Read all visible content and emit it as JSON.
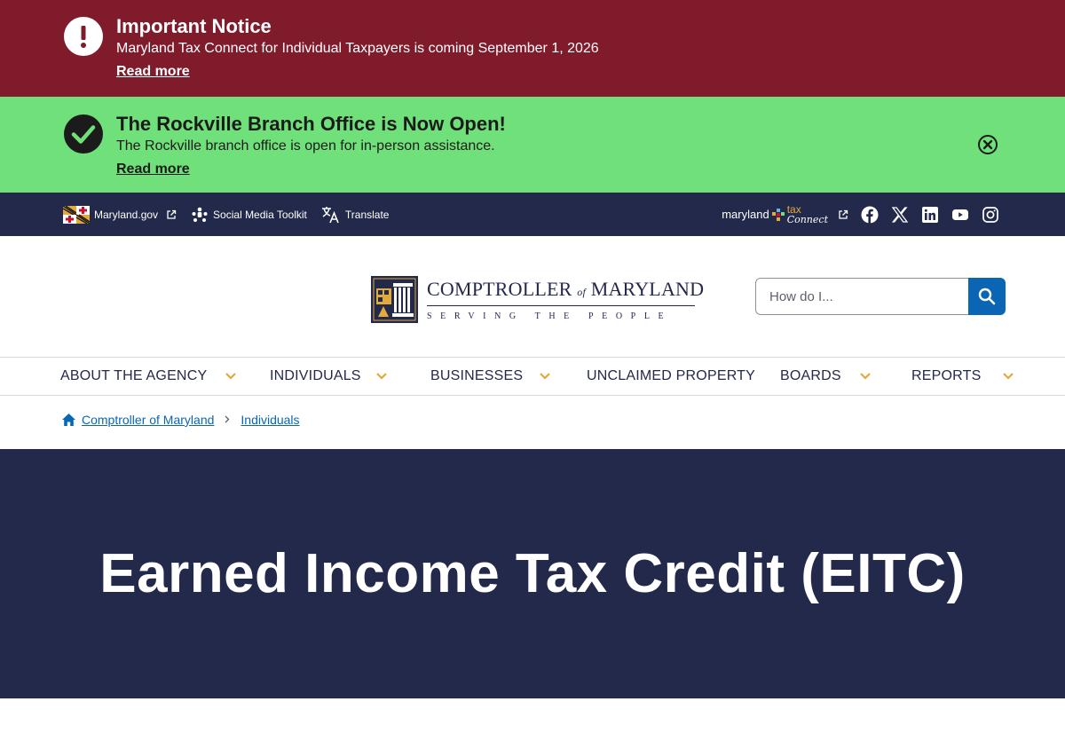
{
  "alerts": {
    "important": {
      "title": "Important Notice",
      "text": "Maryland Tax Connect for Individual Taxpayers is coming September 1, 2026",
      "link": "Read more",
      "icon": "exclamation-icon",
      "color": "#7f1b2b"
    },
    "success": {
      "title": "The Rockville Branch Office is Now Open!",
      "text": "The Rockville branch office is open for in-person assistance.",
      "link": "Read more",
      "icon": "check-circle-icon",
      "color": "#6fe07a"
    }
  },
  "utility": {
    "links": [
      {
        "label": "Maryland.gov",
        "icon": "maryland-flag-icon"
      },
      {
        "label": "Social Media Toolkit",
        "icon": "people-network-icon"
      },
      {
        "label": "Translate",
        "icon": "translate-icon"
      }
    ],
    "tax_connect": {
      "part1": "maryland",
      "part2": "tax",
      "part3": "Connect"
    },
    "social": [
      "facebook-icon",
      "x-icon",
      "linkedin-icon",
      "youtube-icon",
      "instagram-icon"
    ]
  },
  "header": {
    "logo_title_1": "COMPTROLLER",
    "logo_of": "of",
    "logo_title_2": "MARYLAND",
    "logo_sub": "SERVING THE PEOPLE",
    "search_placeholder": "How do I..."
  },
  "nav": {
    "items": [
      {
        "label": "ABOUT THE AGENCY",
        "dropdown": true
      },
      {
        "label": "INDIVIDUALS",
        "dropdown": true
      },
      {
        "label": "BUSINESSES",
        "dropdown": true
      },
      {
        "label": "UNCLAIMED PROPERTY",
        "dropdown": false
      },
      {
        "label": "BOARDS",
        "dropdown": true
      },
      {
        "label": "REPORTS",
        "dropdown": true
      }
    ]
  },
  "breadcrumb": {
    "items": [
      "Comptroller of Maryland",
      "Individuals"
    ]
  },
  "hero": {
    "title": "Earned Income Tax Credit (EITC)"
  },
  "colors": {
    "navy": "#23294a",
    "accent_blue": "#0a66b4",
    "chevron_gold": "#e2a93b"
  }
}
